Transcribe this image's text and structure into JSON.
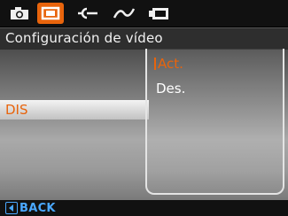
{
  "tabs": [
    {
      "id": "camera",
      "icon": "camera-icon"
    },
    {
      "id": "video",
      "icon": "video-camera-icon",
      "active": true
    },
    {
      "id": "connection",
      "icon": "plug-icon"
    },
    {
      "id": "curve",
      "icon": "curve-wave-icon"
    },
    {
      "id": "playback",
      "icon": "playback-display-icon"
    }
  ],
  "title": "Configuración de vídeo",
  "menu": {
    "item_label": "DIS"
  },
  "options": {
    "selected": "Act.",
    "other": "Des."
  },
  "footer": {
    "back_label": "BACK"
  },
  "colors": {
    "accent": "#e8640c",
    "back": "#4aa8ff"
  }
}
